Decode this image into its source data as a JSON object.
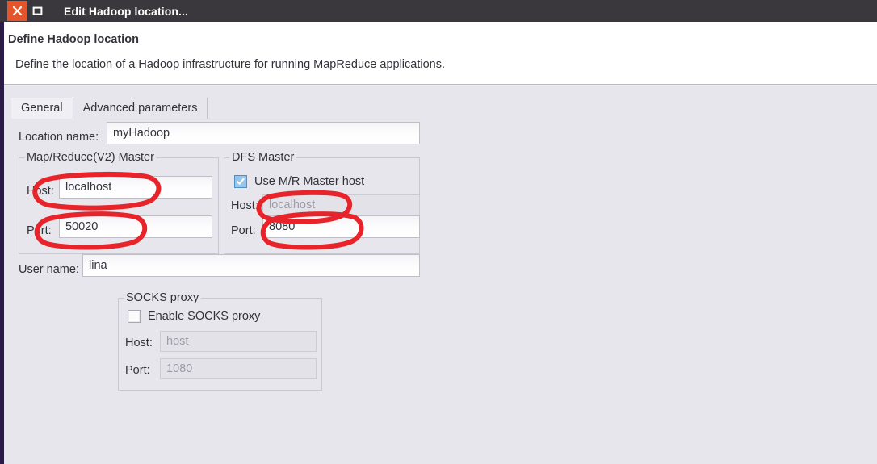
{
  "window": {
    "title": "Edit Hadoop location...",
    "close_icon": "close-icon",
    "maximize_icon": "maximize-icon"
  },
  "header": {
    "title": "Define Hadoop location",
    "description": "Define the location of a Hadoop infrastructure for running MapReduce applications."
  },
  "tabs": [
    {
      "label": "General",
      "active": true
    },
    {
      "label": "Advanced parameters",
      "active": false
    }
  ],
  "form": {
    "location_name": {
      "label": "Location name:",
      "value": "myHadoop"
    },
    "user_name": {
      "label": "User name:",
      "value": "lina"
    }
  },
  "mr_master": {
    "title": "Map/Reduce(V2) Master",
    "host": {
      "label": "Host:",
      "value": "localhost"
    },
    "port": {
      "label": "Port:",
      "value": "50020"
    }
  },
  "dfs_master": {
    "title": "DFS Master",
    "use_mr_host": {
      "label": "Use M/R Master host",
      "checked": true
    },
    "host": {
      "label": "Host:",
      "value": "localhost",
      "disabled": true
    },
    "port": {
      "label": "Port:",
      "value": "8080",
      "disabled": false
    }
  },
  "socks_proxy": {
    "title": "SOCKS proxy",
    "enable": {
      "label": "Enable SOCKS proxy",
      "checked": false
    },
    "host": {
      "label": "Host:",
      "value": "host",
      "disabled": true
    },
    "port": {
      "label": "Port:",
      "value": "1080",
      "disabled": true
    }
  },
  "annotations": {
    "color": "#e8232a",
    "shapes": [
      "mr-host-circle",
      "mr-port-circle",
      "dfs-host-circle",
      "dfs-port-circle"
    ]
  },
  "colors": {
    "titlebar_bg": "#3a383c",
    "close_button_bg": "#e4552b",
    "body_bg": "#e8e6ed",
    "header_bg": "#ffffff",
    "accent_strip": "#2a1b46",
    "checkbox_checked": "#95c6ee",
    "annotation_red": "#e8232a"
  }
}
